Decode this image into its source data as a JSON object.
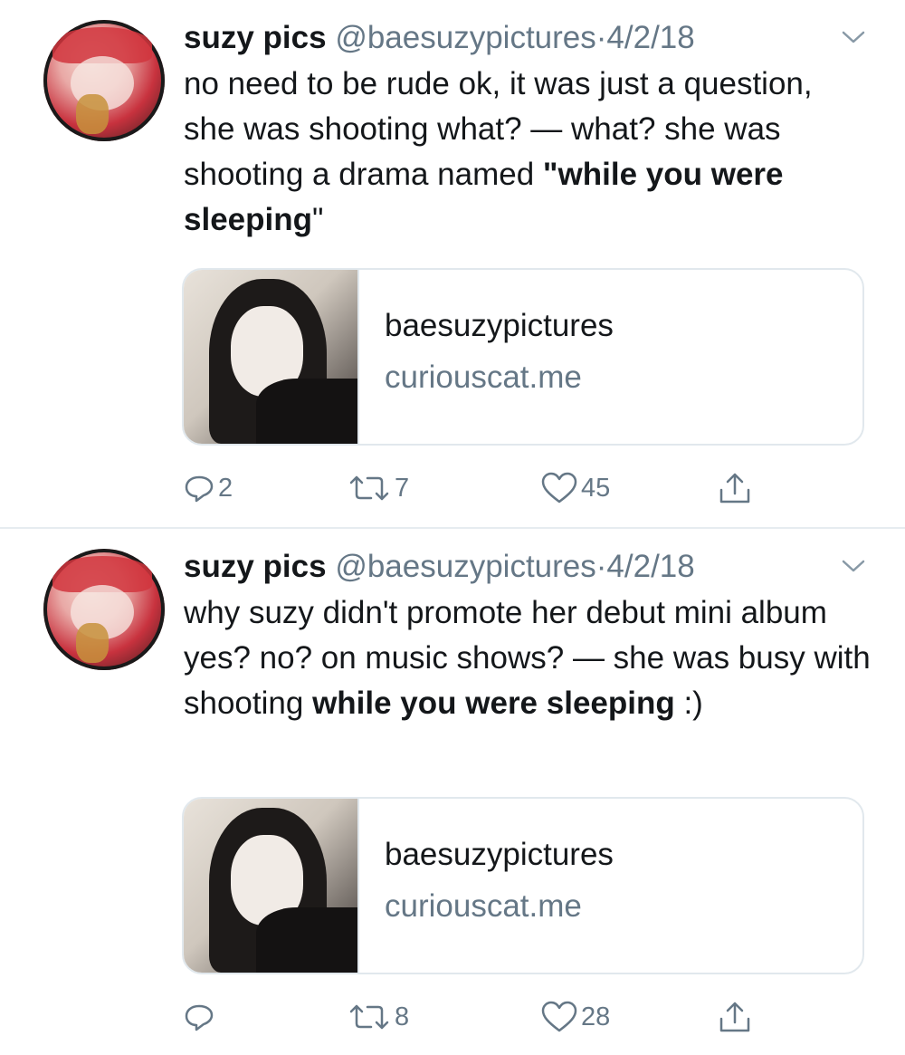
{
  "tweets": [
    {
      "name": "suzy pics",
      "handle": "@baesuzypictures",
      "separator": "·",
      "date": "4/2/18",
      "text_plain": "no need to be rude ok, it was just a question, she was shooting what? — what? she was shooting a drama named ",
      "text_open_quote": "\"",
      "text_bold": "while you were sleeping",
      "text_close_quote": "\"",
      "card": {
        "title": "baesuzypictures",
        "domain": "curiouscat.me"
      },
      "actions": {
        "replies": "2",
        "retweets": "7",
        "likes": "45"
      }
    },
    {
      "name": "suzy pics",
      "handle": "@baesuzypictures",
      "separator": "·",
      "date": "4/2/18",
      "text_plain": "why suzy didn't promote her debut mini album yes? no? on music shows? — she was busy with shooting ",
      "text_bold": "while you were sleeping",
      "text_tail": " :)",
      "card": {
        "title": "baesuzypictures",
        "domain": "curiouscat.me"
      },
      "actions": {
        "replies": "",
        "retweets": "8",
        "likes": "28"
      }
    }
  ],
  "icons": {
    "reply": "reply-icon",
    "retweet": "retweet-icon",
    "like": "heart-icon",
    "share": "share-icon",
    "more": "chevron-down-icon"
  },
  "colors": {
    "secondary_text": "#657786",
    "text": "#14171a",
    "border": "#e1e8ed"
  }
}
